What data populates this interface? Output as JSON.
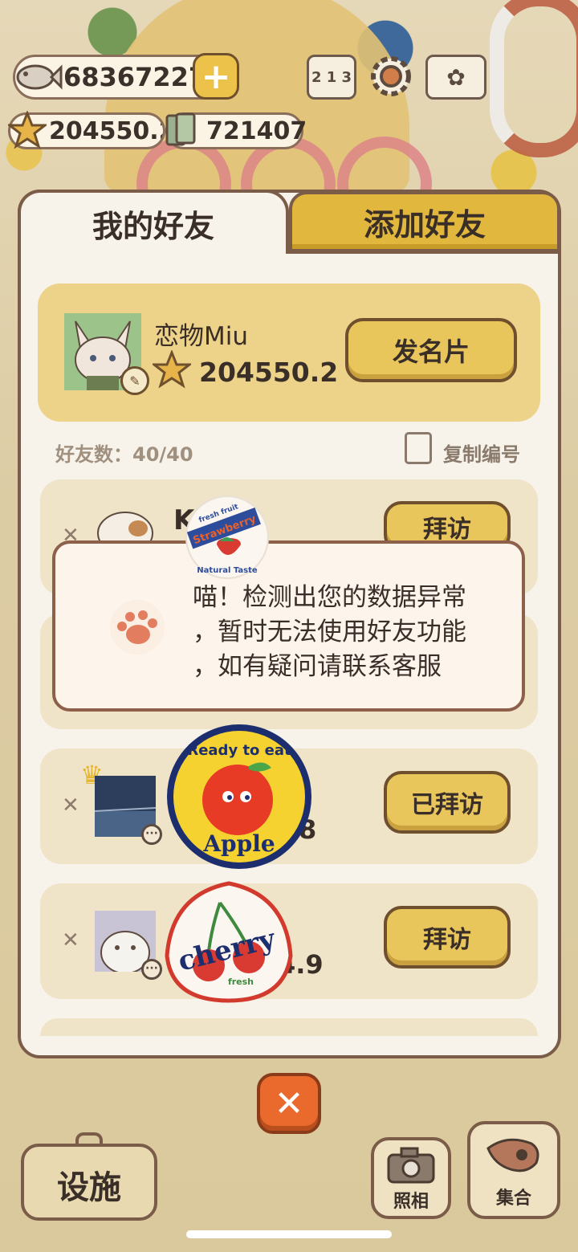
{
  "currency": {
    "fish": "68367227",
    "stars": "204550.2",
    "cards": "721407"
  },
  "tabs": {
    "my_friends": "我的好友",
    "add_friend": "添加好友"
  },
  "profile": {
    "name": "恋物Miu",
    "score": "204550.2",
    "send_card": "发名片"
  },
  "friend_count": {
    "label": "好友数：40/40",
    "copy_id": "复制编号"
  },
  "friends": [
    {
      "name": "K",
      "score": "",
      "action": "拜访"
    },
    {
      "name": "",
      "score": "8",
      "action": "已拜访"
    },
    {
      "name": "",
      "score": "4.9",
      "action": "拜访"
    }
  ],
  "toast": {
    "line1": "喵！检测出您的数据异常",
    "line2": "，暂时无法使用好友功能",
    "line3": "，如有疑问请联系客服"
  },
  "stickers": {
    "strawberry_top": "Strawberry",
    "strawberry_sub": "fresh fruit",
    "strawberry_bottom": "Natural Taste",
    "apple_top": "Ready to eat",
    "apple_bottom": "Apple",
    "cherry": "cherry",
    "cherry_sub": "fresh"
  },
  "bottom": {
    "facility": "设施",
    "photo": "照相",
    "gather": "集合"
  },
  "colors": {
    "gold": "#e9c65b",
    "panel": "#f7f3ea",
    "border": "#7a5c48",
    "close": "#e96a2c"
  }
}
